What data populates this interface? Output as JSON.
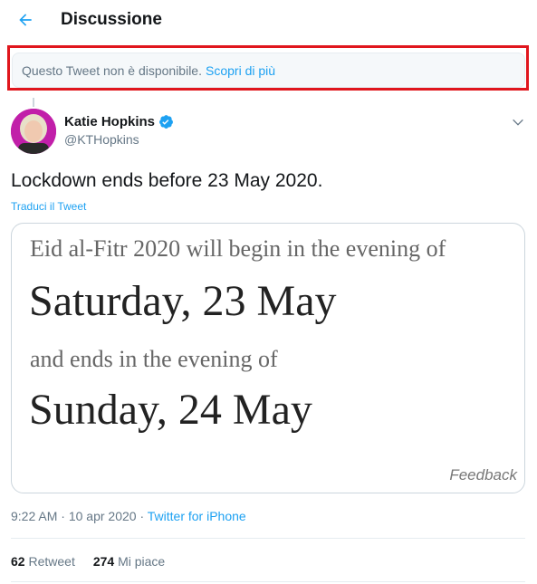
{
  "header": {
    "title": "Discussione",
    "back_icon": "arrow-left-icon"
  },
  "unavailable": {
    "text": "Questo Tweet non è disponibile.",
    "link": "Scopri di più"
  },
  "tweet": {
    "author_name": "Katie Hopkins",
    "author_handle": "@KTHopkins",
    "verified": true,
    "text": "Lockdown ends before 23 May 2020.",
    "translate_label": "Traduci il Tweet",
    "media": {
      "line1": "Eid al-Fitr 2020 will begin in the evening of",
      "date1": "Saturday, 23 May",
      "line2": "and ends in the evening of",
      "date2": "Sunday, 24 May",
      "feedback": "Feedback"
    },
    "time": "9:22 AM",
    "date": "10 apr 2020",
    "separator": " · ",
    "source": "Twitter for iPhone",
    "stats": {
      "retweets_count": "62",
      "retweets_label": "Retweet",
      "likes_count": "274",
      "likes_label": "Mi piace"
    }
  },
  "colors": {
    "accent": "#1da1f2",
    "highlight_border": "#e0161d",
    "avatar_bg": "#c11fa9"
  }
}
